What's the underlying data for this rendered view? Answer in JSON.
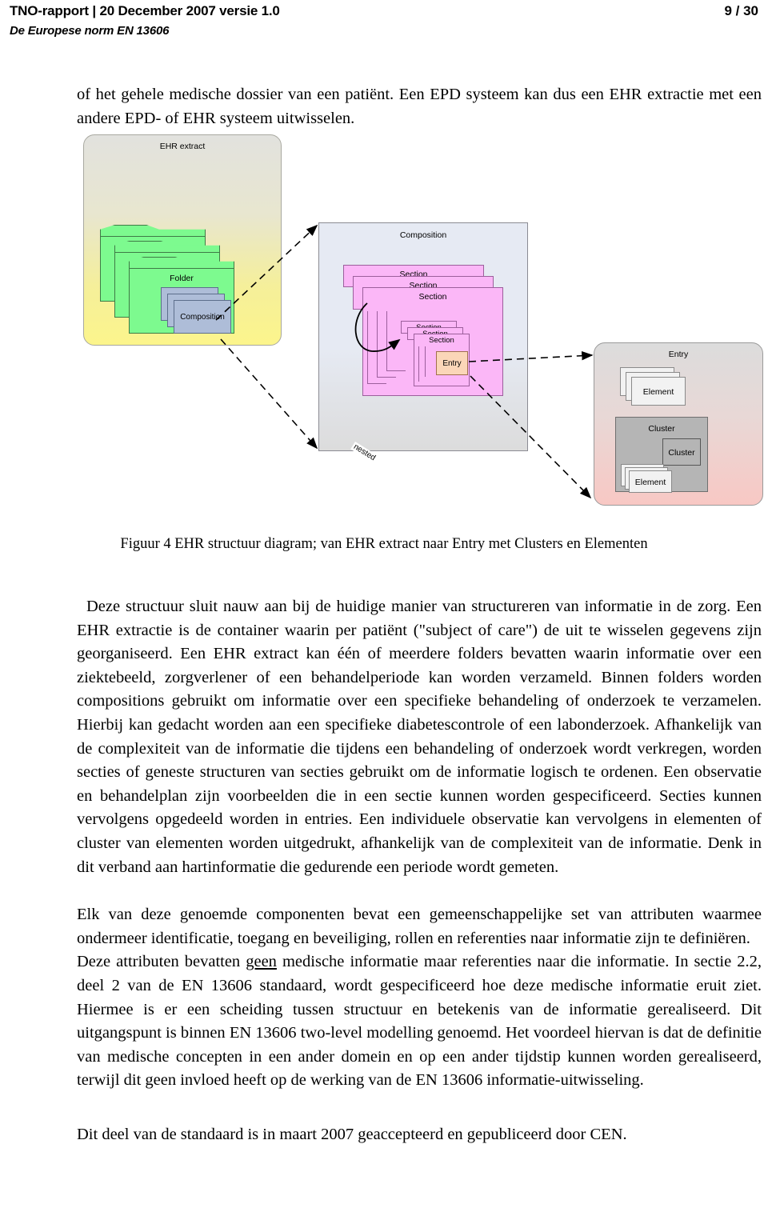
{
  "header": {
    "left": "TNO-rapport | 20 December 2007 versie 1.0",
    "page": "9 / 30",
    "subtitle": "De Europese norm EN 13606"
  },
  "body": {
    "intro": "of het gehele medische dossier van een patiënt. Een EPD systeem kan dus een EHR extractie met een andere EPD- of EHR systeem uitwisselen.",
    "para1": "Deze structuur sluit nauw aan bij de huidige manier van structureren van informatie in de zorg. Een EHR extractie is de container waarin per patiënt (\"subject of care\") de uit te wisselen gegevens zijn georganiseerd. Een EHR extract kan één of meerdere folders bevatten waarin informatie over een ziektebeeld, zorgverlener of een behandelperiode kan worden verzameld. Binnen folders worden compositions gebruikt om informatie over een specifieke behandeling of onderzoek te verzamelen. Hierbij kan gedacht worden aan een specifieke diabetescontrole of een labonderzoek. Afhankelijk van de complexiteit van de informatie die tijdens een behandeling of onderzoek wordt verkregen, worden secties of geneste structuren van secties gebruikt om de informatie logisch te ordenen. Een observatie en behandelplan zijn voorbeelden die in een sectie kunnen worden gespecificeerd. Secties kunnen vervolgens opgedeeld worden in entries. Een individuele observatie kan vervolgens in elementen of cluster van elementen worden uitgedrukt, afhankelijk van de complexiteit van de informatie. Denk in dit verband aan hartinformatie die gedurende een periode wordt gemeten.",
    "para2": "Elk van deze genoemde componenten bevat een gemeenschappelijke set van attributen waarmee ondermeer identificatie, toegang en beveiliging, rollen en referenties naar informatie zijn te definiëren.",
    "para3_before": "Deze attributen bevatten ",
    "para3_underlined": "geen",
    "para3_after": " medische informatie maar referenties naar die informatie. In sectie 2.2, deel 2 van de EN 13606 standaard, wordt gespecificeerd hoe deze medische informatie eruit ziet. Hiermee is er een scheiding tussen structuur en betekenis van de informatie gerealiseerd. Dit uitgangspunt is binnen EN 13606 two-level modelling genoemd. Het voordeel hiervan is dat de definitie van medische concepten in een ander domein en op een ander tijdstip kunnen worden gerealiseerd, terwijl dit geen invloed heeft op de werking van de EN 13606 informatie-uitwisseling.",
    "para4": "Dit deel van de standaard is in maart 2007 geaccepteerd en gepubliceerd door CEN."
  },
  "figure": {
    "caption": "Figuur 4  EHR structuur diagram; van EHR extract naar Entry met Clusters en Elementen",
    "labels": {
      "ehr_extract": "EHR extract",
      "folder": "Folder",
      "composition_inner": "Composition",
      "composition_box": "Composition",
      "section1": "Section",
      "section2": "Section",
      "section3": "Section",
      "nested_section1": "Section",
      "nested_section2": "Section",
      "nested_section3": "Section",
      "nested": "nested",
      "entry_inner": "Entry",
      "entry_box": "Entry",
      "element_top": "Element",
      "cluster_outer": "Cluster",
      "cluster_inner": "Cluster",
      "element_bottom": "Element"
    },
    "colors": {
      "folder_green": "#7dfa8f",
      "composition_blue": "#aebdd8",
      "section_pink": "#fbb7f7",
      "entry_peach": "#fbd6b8",
      "element_grey": "#f2f2f2",
      "cluster_grey": "#b5b5b5",
      "extract_gradient_top": "#e2e2de",
      "extract_gradient_bottom": "#fcf58c",
      "entrybox_gradient_bottom": "#f8c8c4"
    }
  }
}
